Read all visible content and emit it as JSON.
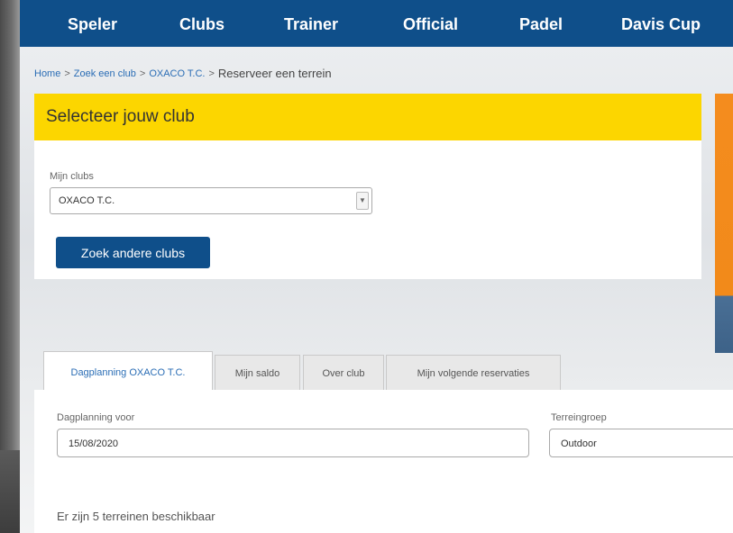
{
  "nav": {
    "items": [
      "Speler",
      "Clubs",
      "Trainer",
      "Official",
      "Padel",
      "Davis Cup"
    ]
  },
  "breadcrumb": {
    "items": [
      "Home",
      "Zoek een club",
      "OXACO T.C."
    ],
    "separator": ">",
    "current": "Reserveer een terrein"
  },
  "club_panel": {
    "title": "Selecteer jouw club",
    "my_clubs_label": "Mijn clubs",
    "selected_club": "OXACO T.C.",
    "search_button": "Zoek andere clubs"
  },
  "tabs": [
    {
      "label": "Dagplanning OXACO T.C.",
      "active": true
    },
    {
      "label": "Mijn saldo",
      "active": false
    },
    {
      "label": "Over club",
      "active": false
    },
    {
      "label": "Mijn volgende reservaties",
      "active": false
    }
  ],
  "planning": {
    "date_label": "Dagplanning voor",
    "date_value": "15/08/2020",
    "group_label": "Terreingroep",
    "group_value": "Outdoor",
    "availability_text": "Er zijn 5 terreinen beschikbaar"
  },
  "colors": {
    "nav_bg": "#0f4f8a",
    "header_yellow": "#fcd600",
    "link_blue": "#2a6db5",
    "banner_orange": "#f48c1e"
  }
}
